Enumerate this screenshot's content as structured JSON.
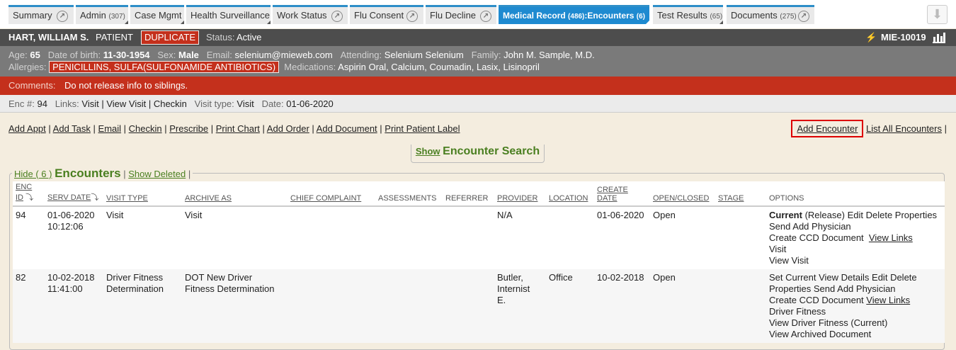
{
  "tabs": [
    {
      "label": "Summary",
      "count": ""
    },
    {
      "label": "Admin",
      "count": "(307)"
    },
    {
      "label": "Case Mgmt",
      "count": ""
    },
    {
      "label": "Health Surveillance",
      "count": ""
    },
    {
      "label": "Work Status",
      "count": ""
    },
    {
      "label": "Flu Consent",
      "count": ""
    },
    {
      "label": "Flu Decline",
      "count": ""
    },
    {
      "label": "Medical Record",
      "count": "(486)",
      "suffix": ":Encounters",
      "suffix_count": "(6)"
    },
    {
      "label": "Test Results",
      "count": "(65)"
    },
    {
      "label": "Documents",
      "count": "(275)"
    }
  ],
  "patient": {
    "name": "HART, WILLIAM S.",
    "type": "PATIENT",
    "flag": "DUPLICATE",
    "status_label": "Status:",
    "status": "Active",
    "id": "MIE-10019",
    "age_label": "Age:",
    "age": "65",
    "dob_label": "Date of birth:",
    "dob": "11-30-1954",
    "sex_label": "Sex:",
    "sex": "Male",
    "email_label": "Email:",
    "email": "selenium@mieweb.com",
    "attending_label": "Attending:",
    "attending": "Selenium Selenium",
    "family_label": "Family:",
    "family": "John M. Sample, M.D.",
    "allergies_label": "Allergies:",
    "allergies": "PENICILLINS, SULFA(SULFONAMIDE ANTIBIOTICS)",
    "meds_label": "Medications:",
    "meds": "Aspirin Oral, Calcium, Coumadin, Lasix, Lisinopril",
    "comments_label": "Comments:",
    "comments": "Do not release info to siblings."
  },
  "encounter": {
    "enc_label": "Enc #:",
    "enc": "94",
    "links_label": "Links:",
    "visit": "Visit",
    "view_visit": "View Visit",
    "checkin": "Checkin",
    "vtype_label": "Visit type:",
    "vtype": "Visit",
    "date_label": "Date:",
    "date": "01-06-2020"
  },
  "actions": [
    "Add Appt",
    "Add Task",
    "Email",
    "Checkin",
    "Prescribe",
    "Print Chart",
    "Add Order",
    "Add Document",
    "Print Patient Label"
  ],
  "right_actions": {
    "add": "Add Encounter",
    "list": "List All Encounters"
  },
  "search": {
    "show": "Show",
    "title": "Encounter Search"
  },
  "legend": {
    "hide": "Hide ( 6 )",
    "title": "Encounters",
    "show_deleted": "Show Deleted"
  },
  "columns": {
    "enc_id_1": "ENC",
    "enc_id_2": "ID",
    "serv_date": "SERV DATE",
    "visit_type": "VISIT TYPE",
    "archive_as": "ARCHIVE AS",
    "chief": "CHIEF COMPLAINT",
    "assess": "ASSESSMENTS",
    "referrer": "REFERRER",
    "provider": "PROVIDER",
    "location": "LOCATION",
    "create_1": "CREATE",
    "create_2": "DATE",
    "open_closed": "OPEN/CLOSED",
    "stage": "STAGE",
    "options": "OPTIONS"
  },
  "rows": [
    {
      "id": "94",
      "date": "01-06-2020",
      "time": "10:12:06",
      "vtype1": "Visit",
      "vtype2": "",
      "arch1": "Visit",
      "arch2": "",
      "provider1": "N/A",
      "provider2": "",
      "provider3": "",
      "location": "",
      "create": "01-06-2020",
      "status": "Open",
      "opts": {
        "current": "Current",
        "release": "(Release)",
        "edit": "Edit",
        "delete": "Delete",
        "properties": "Properties",
        "send": "Send",
        "add_phys": "Add Physician",
        "ccd": "Create CCD Document",
        "view_links": "View Links",
        "visit": "Visit",
        "view_visit": "View Visit"
      }
    },
    {
      "id": "82",
      "date": "10-02-2018",
      "time": "11:41:00",
      "vtype1": "Driver Fitness",
      "vtype2": "Determination",
      "arch1": "DOT New Driver",
      "arch2": "Fitness Determination",
      "provider1": "Butler,",
      "provider2": "Internist",
      "provider3": "E.",
      "location": "Office",
      "create": "10-02-2018",
      "status": "Open",
      "opts": {
        "set_current": "Set Current",
        "view_details": "View Details",
        "edit": "Edit",
        "delete": "Delete",
        "properties": "Properties",
        "send": "Send",
        "add_phys": "Add Physician",
        "ccd": "Create CCD Document",
        "view_links": "View Links",
        "driver": "Driver Fitness",
        "view_driver": "View Driver Fitness (Current)",
        "view_archived": "View Archived Document"
      }
    }
  ]
}
